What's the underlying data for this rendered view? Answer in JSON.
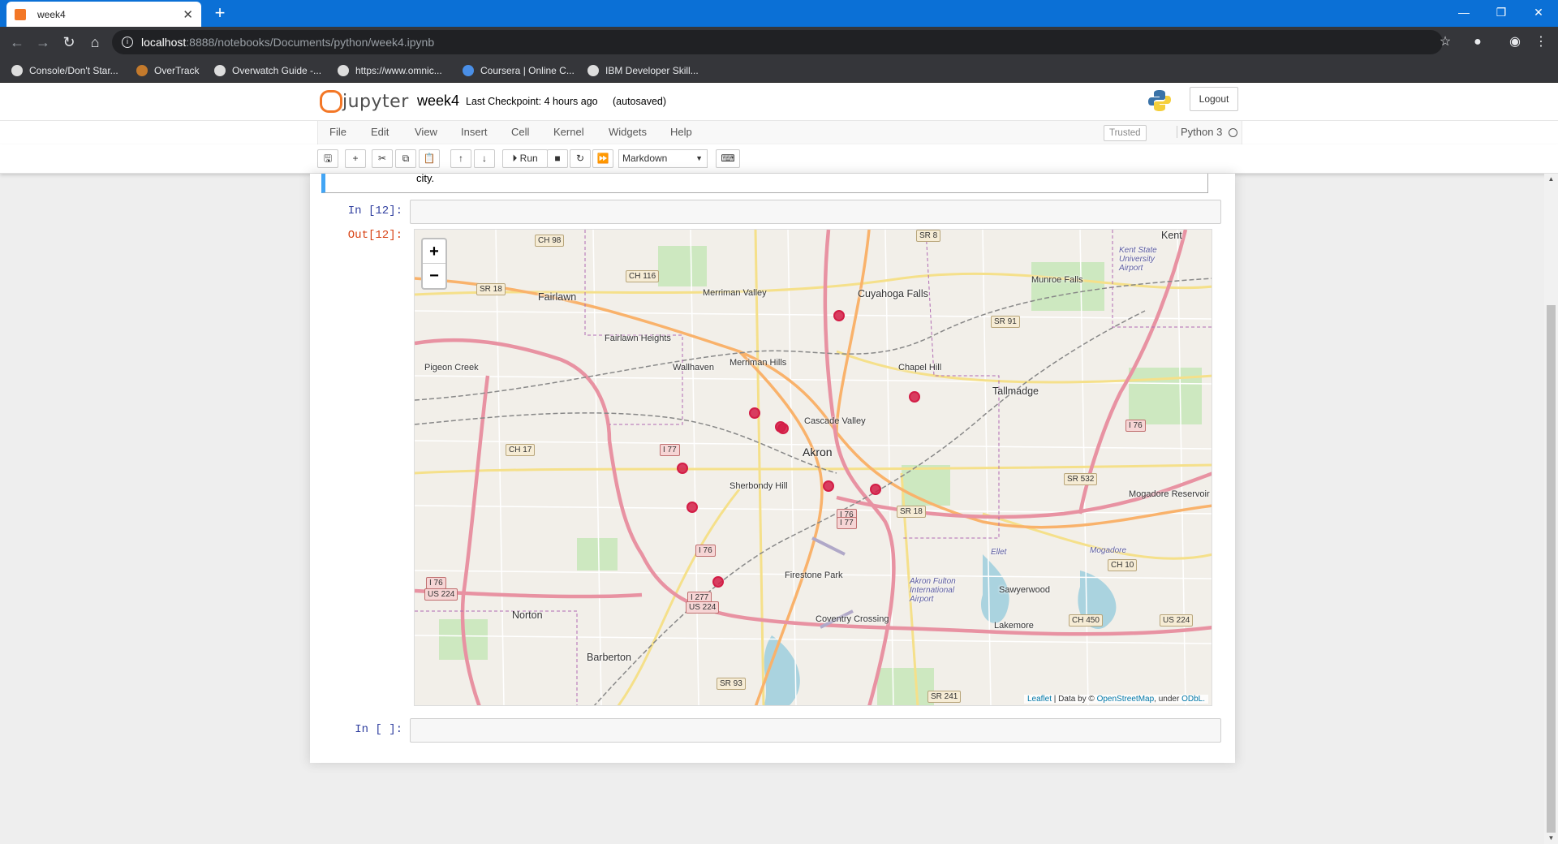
{
  "browser": {
    "tab_title": "week4",
    "url_host": "localhost",
    "url_path": ":8888/notebooks/Documents/python/week4.ipynb",
    "bookmarks": [
      {
        "label": "Console/Don't Star...",
        "color": "#f0f0f0"
      },
      {
        "label": "OverTrack",
        "color": "#c47a2c"
      },
      {
        "label": "Overwatch Guide -...",
        "color": "#ffffff"
      },
      {
        "label": "https://www.omnic...",
        "color": "#ffffff"
      },
      {
        "label": "Coursera | Online C...",
        "color": "#4a8fe7"
      },
      {
        "label": "IBM Developer Skill...",
        "color": "#ffffff"
      }
    ]
  },
  "jupyter": {
    "logo_text": "jupyter",
    "notebook_name": "week4",
    "checkpoint": "Last Checkpoint: 4 hours ago",
    "autosave": "(autosaved)",
    "logout_label": "Logout",
    "menu": [
      "File",
      "Edit",
      "View",
      "Insert",
      "Cell",
      "Kernel",
      "Widgets",
      "Help"
    ],
    "trusted_label": "Trusted",
    "kernel_name": "Python 3",
    "run_label": "Run",
    "cell_type": "Markdown"
  },
  "cells": {
    "prev_text": "city.",
    "in12_prompt": "In [12]:",
    "out12_prompt": "Out[12]:",
    "in_empty_prompt": "In [ ]:"
  },
  "map": {
    "zoom_in": "+",
    "zoom_out": "−",
    "attribution": {
      "leaflet": "Leaflet",
      "data_by": " | Data by © ",
      "osm": "OpenStreetMap",
      "under": ", under ",
      "odbl": "ODbL."
    },
    "labels": [
      {
        "text": "Fairlawn",
        "cls": "city"
      },
      {
        "text": "Merriman Valley",
        "cls": ""
      },
      {
        "text": "Cuyahoga Falls",
        "cls": "city"
      },
      {
        "text": "Munroe Falls",
        "cls": ""
      },
      {
        "text": "Kent",
        "cls": "city"
      },
      {
        "text": "Kent State University Airport",
        "cls": ""
      },
      {
        "text": "Fairlawn Heights",
        "cls": ""
      },
      {
        "text": "Pigeon Creek",
        "cls": ""
      },
      {
        "text": "Wallhaven",
        "cls": ""
      },
      {
        "text": "Merriman Hills",
        "cls": ""
      },
      {
        "text": "Chapel Hill",
        "cls": ""
      },
      {
        "text": "Tallmadge",
        "cls": "city"
      },
      {
        "text": "Cascade Valley",
        "cls": ""
      },
      {
        "text": "Akron",
        "cls": "big"
      },
      {
        "text": "Sherbondy Hill",
        "cls": ""
      },
      {
        "text": "Firestone Park",
        "cls": ""
      },
      {
        "text": "Ellet",
        "cls": ""
      },
      {
        "text": "Mogadore",
        "cls": ""
      },
      {
        "text": "Mogadore Reservoir",
        "cls": ""
      },
      {
        "text": "Sawyerwood",
        "cls": ""
      },
      {
        "text": "Akron Fulton International Airport",
        "cls": ""
      },
      {
        "text": "Norton",
        "cls": "city"
      },
      {
        "text": "Coventry Crossing",
        "cls": ""
      },
      {
        "text": "Lakemore",
        "cls": ""
      },
      {
        "text": "Barberton",
        "cls": "city"
      }
    ],
    "shields": [
      {
        "text": "CH 98",
        "cls": ""
      },
      {
        "text": "CH 116",
        "cls": ""
      },
      {
        "text": "SR 18",
        "cls": ""
      },
      {
        "text": "SR 8",
        "cls": ""
      },
      {
        "text": "SR 91",
        "cls": ""
      },
      {
        "text": "I 77",
        "cls": "i"
      },
      {
        "text": "CH 17",
        "cls": ""
      },
      {
        "text": "I 76",
        "cls": "i"
      },
      {
        "text": "SR 532",
        "cls": ""
      },
      {
        "text": "I 76",
        "cls": "i"
      },
      {
        "text": "I 77",
        "cls": "i"
      },
      {
        "text": "SR 18",
        "cls": ""
      },
      {
        "text": "I 76",
        "cls": "i"
      },
      {
        "text": "I 76",
        "cls": "i"
      },
      {
        "text": "US 224",
        "cls": "i"
      },
      {
        "text": "I 277",
        "cls": "i"
      },
      {
        "text": "US 224",
        "cls": "i"
      },
      {
        "text": "CH 10",
        "cls": ""
      },
      {
        "text": "CH 450",
        "cls": ""
      },
      {
        "text": "US 224",
        "cls": ""
      },
      {
        "text": "SR 93",
        "cls": ""
      },
      {
        "text": "SR 241",
        "cls": ""
      }
    ],
    "marker_color": "#d31d46",
    "marker_count": 9
  }
}
